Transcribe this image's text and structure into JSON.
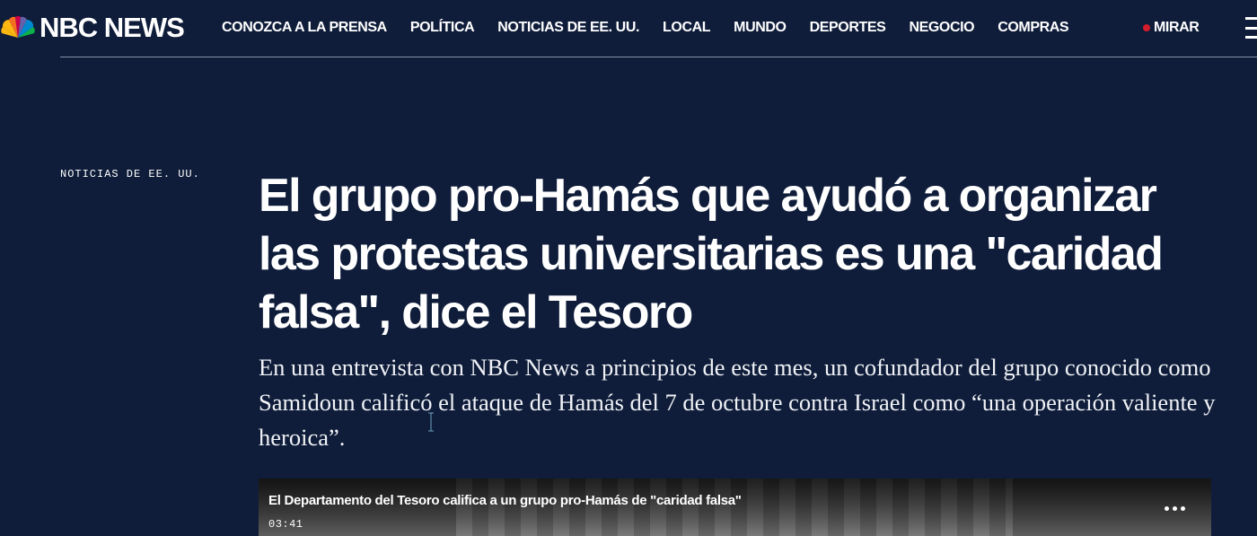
{
  "brand": {
    "name": "NBC NEWS"
  },
  "nav": {
    "items": [
      {
        "label": "CONOZCA A LA PRENSA"
      },
      {
        "label": "POLÍTICA"
      },
      {
        "label": "NOTICIAS DE EE. UU."
      },
      {
        "label": "LOCAL"
      },
      {
        "label": "MUNDO"
      },
      {
        "label": "DEPORTES"
      },
      {
        "label": "NEGOCIO"
      },
      {
        "label": "COMPRAS"
      }
    ],
    "watch_label": "MIRAR",
    "watch_dot_color": "#d11d2c"
  },
  "article": {
    "section": "NOTICIAS DE EE. UU.",
    "headline": "El grupo pro-Hamás que ayudó a organizar las protestas universitarias es una \"caridad falsa\", dice el Tesoro",
    "dek": "En una entrevista con NBC News a principios de este mes, un cofundador del grupo conocido como Samidoun calificó el ataque de Hamás del 7 de octubre contra Israel como “una operación valiente y heroica”."
  },
  "video": {
    "title": "El Departamento del Tesoro califica a un grupo pro-Hamás de \"caridad falsa\"",
    "duration": "03:41",
    "more_icon": "ellipsis-icon"
  },
  "colors": {
    "background": "#0f1d3a",
    "text": "#ffffff"
  }
}
